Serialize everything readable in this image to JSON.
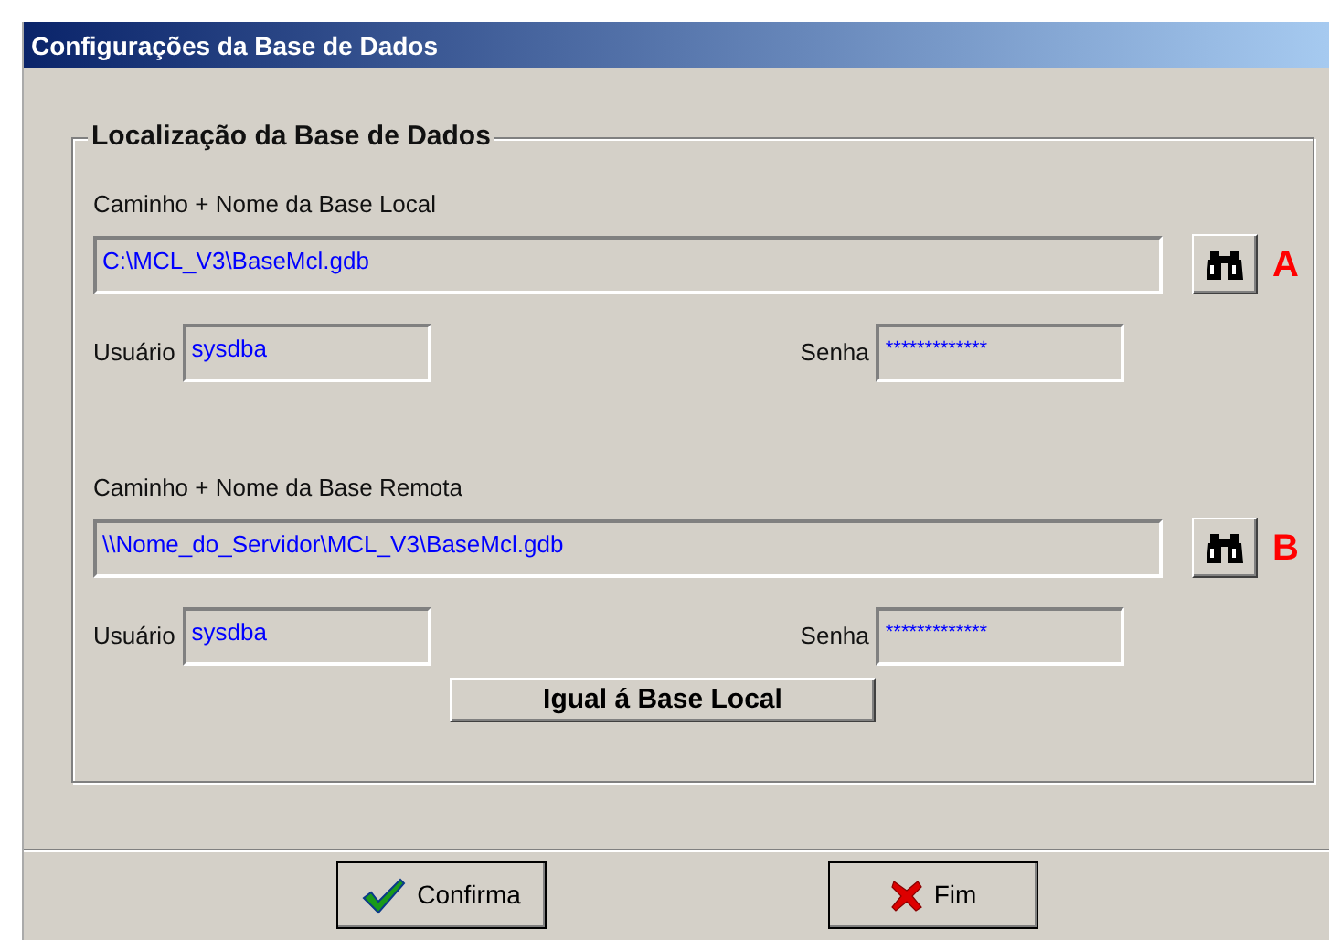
{
  "window": {
    "title": "Configurações da Base de Dados"
  },
  "group": {
    "title": "Localização da Base de Dados",
    "sections": [
      {
        "path_label": "Caminho + Nome da Base Local",
        "path_value": "C:\\MCL_V3\\BaseMcl.gdb",
        "marker": "A",
        "user_label": "Usuário",
        "user_value": "sysdba",
        "password_label": "Senha",
        "password_value": "*************"
      },
      {
        "path_label": "Caminho + Nome da Base Remota",
        "path_value": "\\\\Nome_do_Servidor\\MCL_V3\\BaseMcl.gdb",
        "marker": "B",
        "user_label": "Usuário",
        "user_value": "sysdba",
        "password_label": "Senha",
        "password_value": "*************"
      }
    ],
    "copy_button": "Igual á Base Local"
  },
  "buttons": [
    {
      "label": "Confirma",
      "kind": "confirm"
    },
    {
      "label": "Fim",
      "kind": "cancel"
    }
  ]
}
